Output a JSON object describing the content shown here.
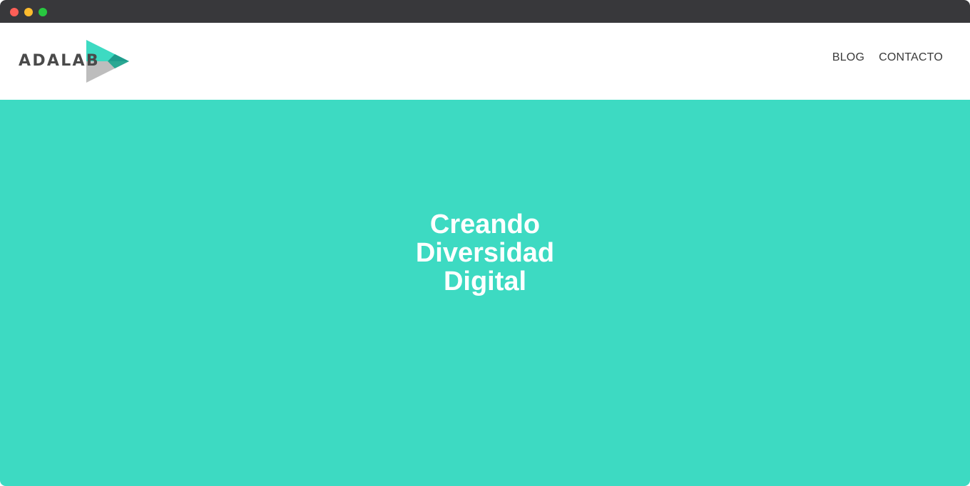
{
  "window": {
    "controls": [
      "close",
      "minimize",
      "maximize"
    ]
  },
  "header": {
    "logo_text": "ADALAB",
    "logo_icon": "play-triangle-icon",
    "nav": [
      {
        "label": "BLOG"
      },
      {
        "label": "CONTACTO"
      }
    ]
  },
  "hero": {
    "title_lines": [
      "Creando",
      "Diversidad",
      "Digital"
    ]
  },
  "colors": {
    "titlebar": "#38383b",
    "hero_background": "#3ddac2",
    "logo_teal": "#3ddac2",
    "logo_dark_teal": "#1e9c8c",
    "logo_gray": "#bdbdbd",
    "logo_text": "#4a4a4a",
    "nav_text": "#3a3a3a",
    "hero_text": "#ffffff"
  }
}
